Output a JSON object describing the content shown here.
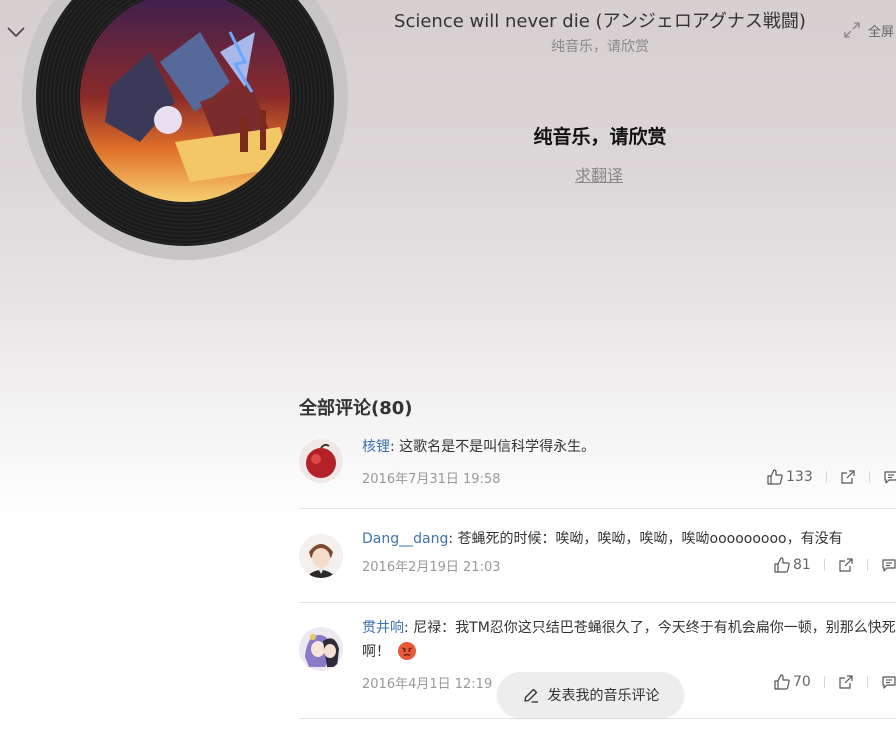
{
  "header": {
    "song_title": "Science will never die (アンジェロアグナス戦闘)",
    "subtitle": "纯音乐，请欣赏",
    "fullscreen_label": "全屏"
  },
  "lyrics": {
    "current_line": "纯音乐，请欣赏",
    "translate_label": "求翻译"
  },
  "comments_section": {
    "heading": "全部评论(80)",
    "comments": [
      {
        "user": "核锂",
        "separator": ": ",
        "text": "这歌名是不是叫信科学得永生。",
        "time": "2016年7月31日 19:58",
        "likes": "133"
      },
      {
        "user": "Dang__dang",
        "separator": ": ",
        "text": "苍蝇死的时候：唉呦，唉呦，唉呦，唉呦ooooooooo，有没有",
        "time": "2016年2月19日 21:03",
        "likes": "81"
      },
      {
        "user": "贯井响",
        "separator": ": ",
        "text": "尼禄：我TM忍你这只结巴苍蝇很久了，今天终于有机会扁你一顿，别那么快死啊！",
        "time": "2016年4月1日 12:19",
        "likes": "70",
        "emoji": "angry-face"
      }
    ]
  },
  "post_comment": {
    "label": "发表我的音乐评论"
  },
  "icons": {
    "collapse": "chevron-down-icon",
    "fullscreen": "fullscreen-icon",
    "like": "thumbs-up-icon",
    "share": "share-icon",
    "reply": "comment-icon",
    "edit": "pencil-icon"
  },
  "colors": {
    "username": "#3e73b0",
    "time": "#999999",
    "emoji": "#e85a3a"
  }
}
